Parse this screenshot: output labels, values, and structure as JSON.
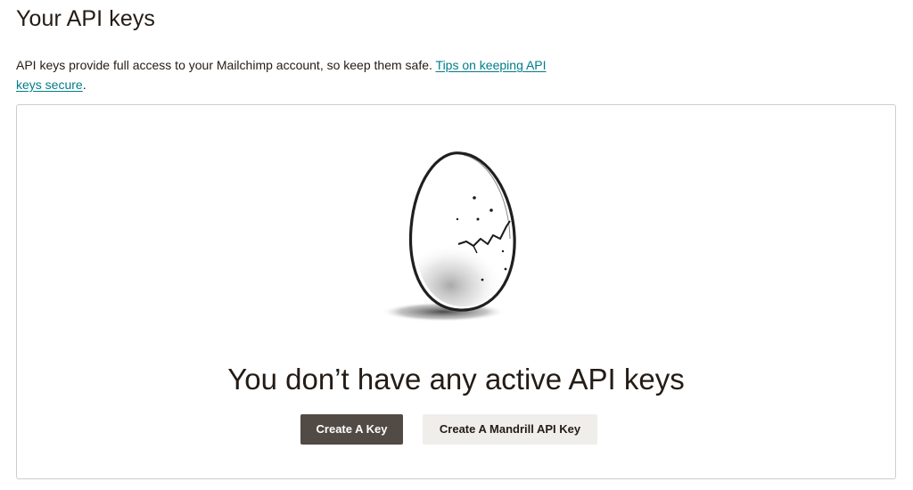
{
  "page": {
    "title": "Your API keys",
    "intro_text": "API keys provide full access to your Mailchimp account, so keep them safe. ",
    "intro_link": "Tips on keeping API keys secure",
    "intro_end": "."
  },
  "empty_state": {
    "illustration": "cracked-egg-illustration",
    "title": "You don’t have any active API keys",
    "create_key_label": "Create A Key",
    "create_mandrill_label": "Create A Mandrill API Key"
  },
  "colors": {
    "link": "#007c89",
    "primary_button": "#524a44",
    "secondary_button": "#efeeea",
    "text": "#241c15"
  }
}
